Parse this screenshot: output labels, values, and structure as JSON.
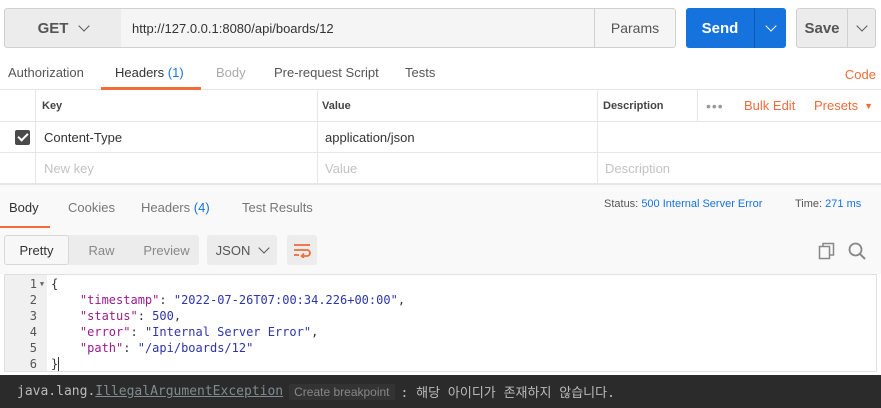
{
  "request": {
    "method": "GET",
    "url": "http://127.0.0.1:8080/api/boards/12",
    "params_label": "Params",
    "send_label": "Send",
    "save_label": "Save"
  },
  "request_tabs": {
    "authorization": "Authorization",
    "headers": "Headers",
    "headers_count": "(1)",
    "body": "Body",
    "pre_request_script": "Pre-request Script",
    "tests": "Tests",
    "code": "Code"
  },
  "headers_table": {
    "col_key": "Key",
    "col_value": "Value",
    "col_description": "Description",
    "more": "•••",
    "bulk_edit": "Bulk Edit",
    "presets": "Presets",
    "rows": [
      {
        "key": "Content-Type",
        "value": "application/json",
        "enabled": true
      }
    ],
    "placeholder": {
      "key": "New key",
      "value": "Value",
      "description": "Description"
    }
  },
  "response_tabs": {
    "body": "Body",
    "cookies": "Cookies",
    "headers": "Headers",
    "headers_count": "(4)",
    "test_results": "Test Results",
    "status_label": "Status:",
    "status_value": "500 Internal Server Error",
    "time_label": "Time:",
    "time_value": "271 ms"
  },
  "view_options": {
    "pretty": "Pretty",
    "raw": "Raw",
    "preview": "Preview",
    "format": "JSON"
  },
  "response_body": {
    "line_numbers": [
      "1",
      "2",
      "3",
      "4",
      "5",
      "6"
    ],
    "open_brace": "{",
    "close_brace": "}",
    "fields": [
      {
        "key": "\"timestamp\"",
        "value": "\"2022-07-26T07:00:34.226+00:00\"",
        "sep": ","
      },
      {
        "key": "\"status\"",
        "value": "500",
        "sep": ","
      },
      {
        "key": "\"error\"",
        "value": "\"Internal Server Error\"",
        "sep": ","
      },
      {
        "key": "\"path\"",
        "value": "\"/api/boards/12\"",
        "sep": ""
      }
    ]
  },
  "console": {
    "prefix": "java.lang.",
    "exception": "IllegalArgumentException",
    "breakpoint": "Create breakpoint",
    "message": ": 해당 아이디가 존재하지 않습니다."
  },
  "colors": {
    "accent_orange": "#f26b3a",
    "send_blue": "#1672dd"
  }
}
